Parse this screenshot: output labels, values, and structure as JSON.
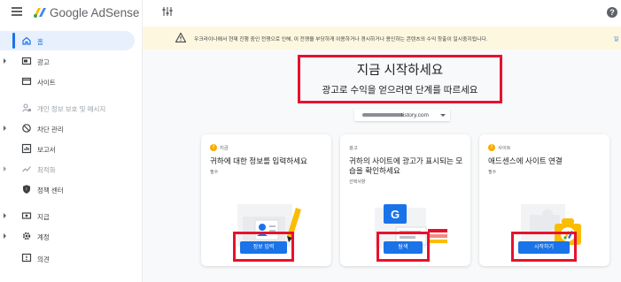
{
  "app": {
    "name": "Google AdSense"
  },
  "sidebar": {
    "items": [
      {
        "label": "홈",
        "icon": "home-icon",
        "active": true
      },
      {
        "label": "광고",
        "icon": "ad-icon"
      },
      {
        "label": "사이트",
        "icon": "site-icon"
      },
      {
        "label": "개인 정보 보호 및 메시지",
        "icon": "privacy-icon",
        "disabled": true
      },
      {
        "label": "차단 관리",
        "icon": "block-icon"
      },
      {
        "label": "보고서",
        "icon": "report-icon"
      },
      {
        "label": "최적화",
        "icon": "optimize-icon",
        "disabled": true
      },
      {
        "label": "정책 센터",
        "icon": "policy-icon"
      },
      {
        "label": "지급",
        "icon": "payment-icon"
      },
      {
        "label": "계정",
        "icon": "gear-icon"
      },
      {
        "label": "의견",
        "icon": "feedback-icon"
      }
    ]
  },
  "banner": {
    "text": "우크라이나에서 현재 진행 중인 전쟁으로 인해, 이 전쟁을 부당하게 이용하거나 경시하거나 용인하는 콘텐츠의 수익 창출이 일시중지됩니다.",
    "link": "일"
  },
  "hero": {
    "title": "지금 시작하세요",
    "subtitle": "광고로 수익을 얻으려면 단계를 따르세요"
  },
  "site_selector": {
    "value": "tistory.com"
  },
  "cards": [
    {
      "tag": "지금",
      "has_badge": true,
      "title": "귀하에 대한 정보를 입력하세요",
      "req": "필수",
      "button": "정보 입력"
    },
    {
      "tag": "광고",
      "has_badge": false,
      "title": "귀하의 사이트에 광고가 표시되는 모습을 확인하세요",
      "req": "선택사항",
      "button": "탐색"
    },
    {
      "tag": "사이트",
      "has_badge": true,
      "title": "애드센스에 사이트 연결",
      "req": "필수",
      "button": "시작하기"
    }
  ],
  "colors": {
    "accent": "#1a73e8",
    "highlight": "#e8112d",
    "warning_bg": "#fef7e0"
  }
}
